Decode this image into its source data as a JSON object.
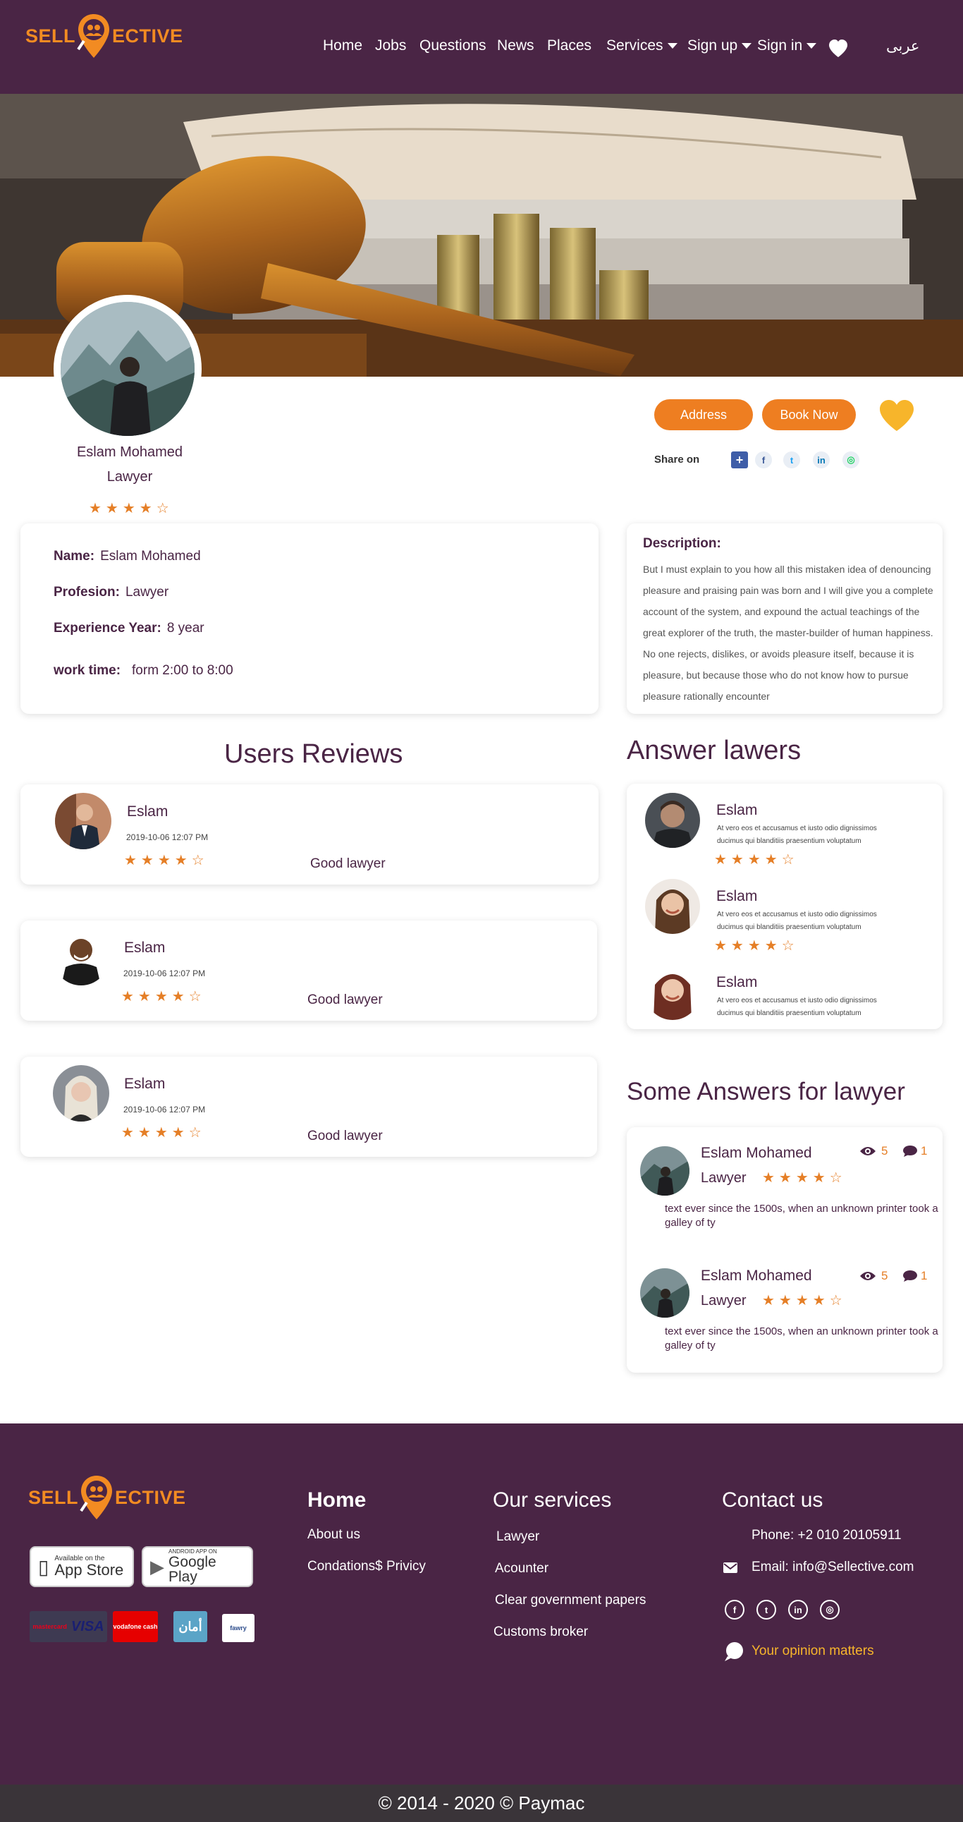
{
  "header": {
    "logo_left": "SELL",
    "logo_right": "ECTIVE",
    "nav": [
      {
        "label": "Home"
      },
      {
        "label": "Jobs"
      },
      {
        "label": "Questions"
      },
      {
        "label": "News"
      },
      {
        "label": "Places"
      },
      {
        "label": "Services"
      },
      {
        "label": "Sign up"
      },
      {
        "label": "Sign in"
      }
    ],
    "favorites_icon": "heart-icon",
    "language": "عربى"
  },
  "profile": {
    "name": "Eslam Mohamed",
    "role": "Lawyer",
    "rating": 4,
    "rating_max": 5,
    "address_button": "Address",
    "book_button": "Book Now",
    "share_label": "Share on",
    "share_icons": [
      "share-plus-icon",
      "facebook-icon",
      "twitter-icon",
      "linkedin-icon",
      "whatsapp-icon"
    ]
  },
  "info": {
    "name_label": "Name:",
    "name_value": "Eslam Mohamed",
    "profession_label": "Profesion:",
    "profession_value": "Lawyer",
    "experience_label": "Experience Year:",
    "experience_value": "8 year",
    "worktime_label": "work time:",
    "worktime_value": "form 2:00 to 8:00"
  },
  "description": {
    "title": "Description:",
    "text": "But I must explain to you how all this mistaken idea of denouncing pleasure and praising pain was born and I will give you a complete account of the system, and expound the actual teachings of the great explorer of the truth, the master-builder of human happiness. No one rejects, dislikes, or avoids pleasure itself, because it is pleasure, but because those who do not know how to pursue pleasure rationally encounter"
  },
  "reviews": {
    "title": "Users Reviews",
    "items": [
      {
        "name": "Eslam",
        "date": "2019-10-06 12:07 PM",
        "rating": 4,
        "text": "Good lawyer"
      },
      {
        "name": "Eslam",
        "date": "2019-10-06 12:07 PM",
        "rating": 4,
        "text": "Good lawyer"
      },
      {
        "name": "Eslam",
        "date": "2019-10-06 12:07 PM",
        "rating": 4,
        "text": "Good lawyer"
      }
    ]
  },
  "answer_lawyers": {
    "title": "Answer lawers",
    "items": [
      {
        "name": "Eslam",
        "text": "At vero eos et accusamus et iusto odio dignissimos ducimus qui blanditiis praesentium voluptatum",
        "rating": 4
      },
      {
        "name": "Eslam",
        "text": "At vero eos et accusamus et iusto odio dignissimos ducimus qui blanditiis praesentium voluptatum",
        "rating": 4
      },
      {
        "name": "Eslam",
        "text": "At vero eos et accusamus et iusto odio dignissimos ducimus qui blanditiis praesentium voluptatum"
      }
    ]
  },
  "some_answers": {
    "title": "Some Answers for  lawyer",
    "items": [
      {
        "name": "Eslam Mohamed",
        "role": "Lawyer",
        "rating": 4,
        "views": "5",
        "comments": "1",
        "text": "text ever since the 1500s, when an unknown printer took a galley of ty"
      },
      {
        "name": "Eslam Mohamed",
        "role": "Lawyer",
        "rating": 4,
        "views": "5",
        "comments": "1",
        "text": "text ever since the 1500s, when an unknown printer took a galley of ty"
      }
    ]
  },
  "footer": {
    "logo_left": "SELL",
    "logo_right": "ECTIVE",
    "app_store_small": "Available on the",
    "app_store_big": "App Store",
    "google_small": "ANDROID APP ON",
    "google_big": "Google Play",
    "payment_labels": [
      "mastercard",
      "VISA",
      "vodafone cash",
      "أمان",
      "fawry"
    ],
    "col_home_title": "Home",
    "col_home_links": [
      "About us",
      "Condations$ Privicy"
    ],
    "col_services_title": "Our services",
    "col_services_links": [
      "Lawyer",
      "Acounter",
      "Clear government papers",
      "Customs broker"
    ],
    "col_contact_title": "Contact us",
    "phone": "Phone: +2 010 20105911",
    "email": "Email: info@Sellective.com",
    "social_icons": [
      "facebook-icon",
      "twitter-icon",
      "linkedin-icon",
      "whatsapp-icon"
    ],
    "opinion": "Your opinion matters",
    "copyright": "© 2014 - 2020 © Paymac"
  },
  "colors": {
    "brand_purple": "#4a2545",
    "accent_orange": "#ee7e21",
    "star_orange": "#e57f27",
    "heart_yellow": "#f7b52b",
    "footer_bottom": "#3a3439"
  }
}
